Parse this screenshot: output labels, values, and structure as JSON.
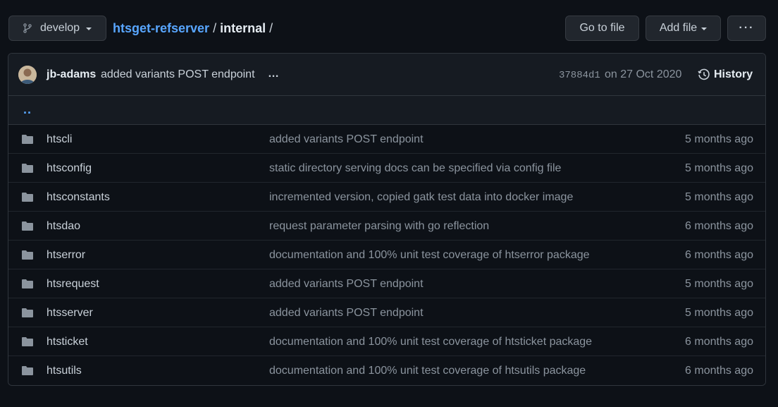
{
  "toolbar": {
    "branch_label": "develop",
    "goto_label": "Go to file",
    "addfile_label": "Add file",
    "more_label": "···"
  },
  "breadcrumb": {
    "repo": "htsget-refserver",
    "separator": "/",
    "dir": "internal",
    "trailing_separator": "/"
  },
  "commit": {
    "author": "jb-adams",
    "message": "added variants POST endpoint",
    "ellipsis": "…",
    "sha": "37884d1",
    "date": "on 27 Oct 2020",
    "history_label": "History"
  },
  "parent_link": "..",
  "files": [
    {
      "name": "htscli",
      "message": "added variants POST endpoint",
      "age": "5 months ago",
      "icon": "folder-icon"
    },
    {
      "name": "htsconfig",
      "message": "static directory serving docs can be specified via config file",
      "age": "5 months ago",
      "icon": "folder-icon"
    },
    {
      "name": "htsconstants",
      "message": "incremented version, copied gatk test data into docker image",
      "age": "5 months ago",
      "icon": "folder-icon"
    },
    {
      "name": "htsdao",
      "message": "request parameter parsing with go reflection",
      "age": "6 months ago",
      "icon": "folder-icon"
    },
    {
      "name": "htserror",
      "message": "documentation and 100% unit test coverage of htserror package",
      "age": "6 months ago",
      "icon": "folder-icon"
    },
    {
      "name": "htsrequest",
      "message": "added variants POST endpoint",
      "age": "5 months ago",
      "icon": "folder-icon"
    },
    {
      "name": "htsserver",
      "message": "added variants POST endpoint",
      "age": "5 months ago",
      "icon": "folder-icon"
    },
    {
      "name": "htsticket",
      "message": "documentation and 100% unit test coverage of htsticket package",
      "age": "6 months ago",
      "icon": "folder-icon"
    },
    {
      "name": "htsutils",
      "message": "documentation and 100% unit test coverage of htsutils package",
      "age": "6 months ago",
      "icon": "folder-icon"
    }
  ],
  "colors": {
    "background": "#0d1117",
    "header_bg": "#161b22",
    "link": "#58a6ff",
    "muted": "#8b949e",
    "folder": "#8b949e"
  }
}
